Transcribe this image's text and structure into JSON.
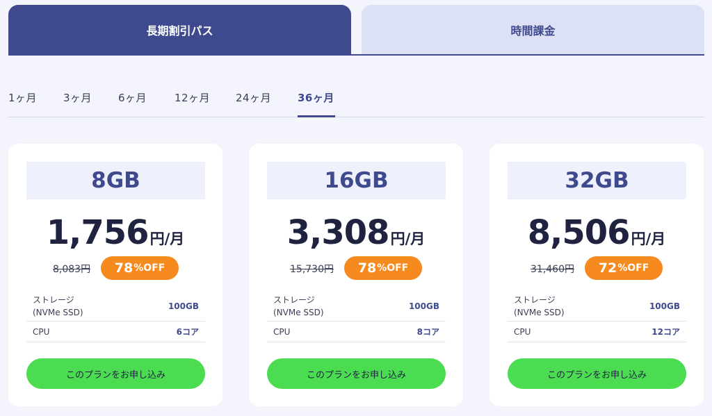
{
  "plan_tabs": {
    "active": "長期割引パス",
    "inactive": "時間課金"
  },
  "duration_tabs": [
    "1ヶ月",
    "3ヶ月",
    "6ヶ月",
    "12ヶ月",
    "24ヶ月",
    "36ヶ月"
  ],
  "active_duration": "36ヶ月",
  "cards": [
    {
      "memory": "8GB",
      "price": "1,756",
      "unit": "円/月",
      "old_price": "8,083円",
      "discount_num": "78",
      "discount_text": "%OFF",
      "storage_label_1": "ストレージ",
      "storage_label_2": "(NVMe SSD)",
      "storage_value": "100GB",
      "cpu_label": "CPU",
      "cpu_value": "6コア",
      "button": "このプランをお申し込み"
    },
    {
      "memory": "16GB",
      "price": "3,308",
      "unit": "円/月",
      "old_price": "15,730円",
      "discount_num": "78",
      "discount_text": "%OFF",
      "storage_label_1": "ストレージ",
      "storage_label_2": "(NVMe SSD)",
      "storage_value": "100GB",
      "cpu_label": "CPU",
      "cpu_value": "8コア",
      "button": "このプランをお申し込み"
    },
    {
      "memory": "32GB",
      "price": "8,506",
      "unit": "円/月",
      "old_price": "31,460円",
      "discount_num": "72",
      "discount_text": "%OFF",
      "storage_label_1": "ストレージ",
      "storage_label_2": "(NVMe SSD)",
      "storage_value": "100GB",
      "cpu_label": "CPU",
      "cpu_value": "12コア",
      "button": "このプランをお申し込み"
    }
  ],
  "colors": {
    "primary": "#3f4a8e",
    "accent_orange": "#f68a1f",
    "button_green": "#4bdc52",
    "background": "#f3f4fc"
  }
}
